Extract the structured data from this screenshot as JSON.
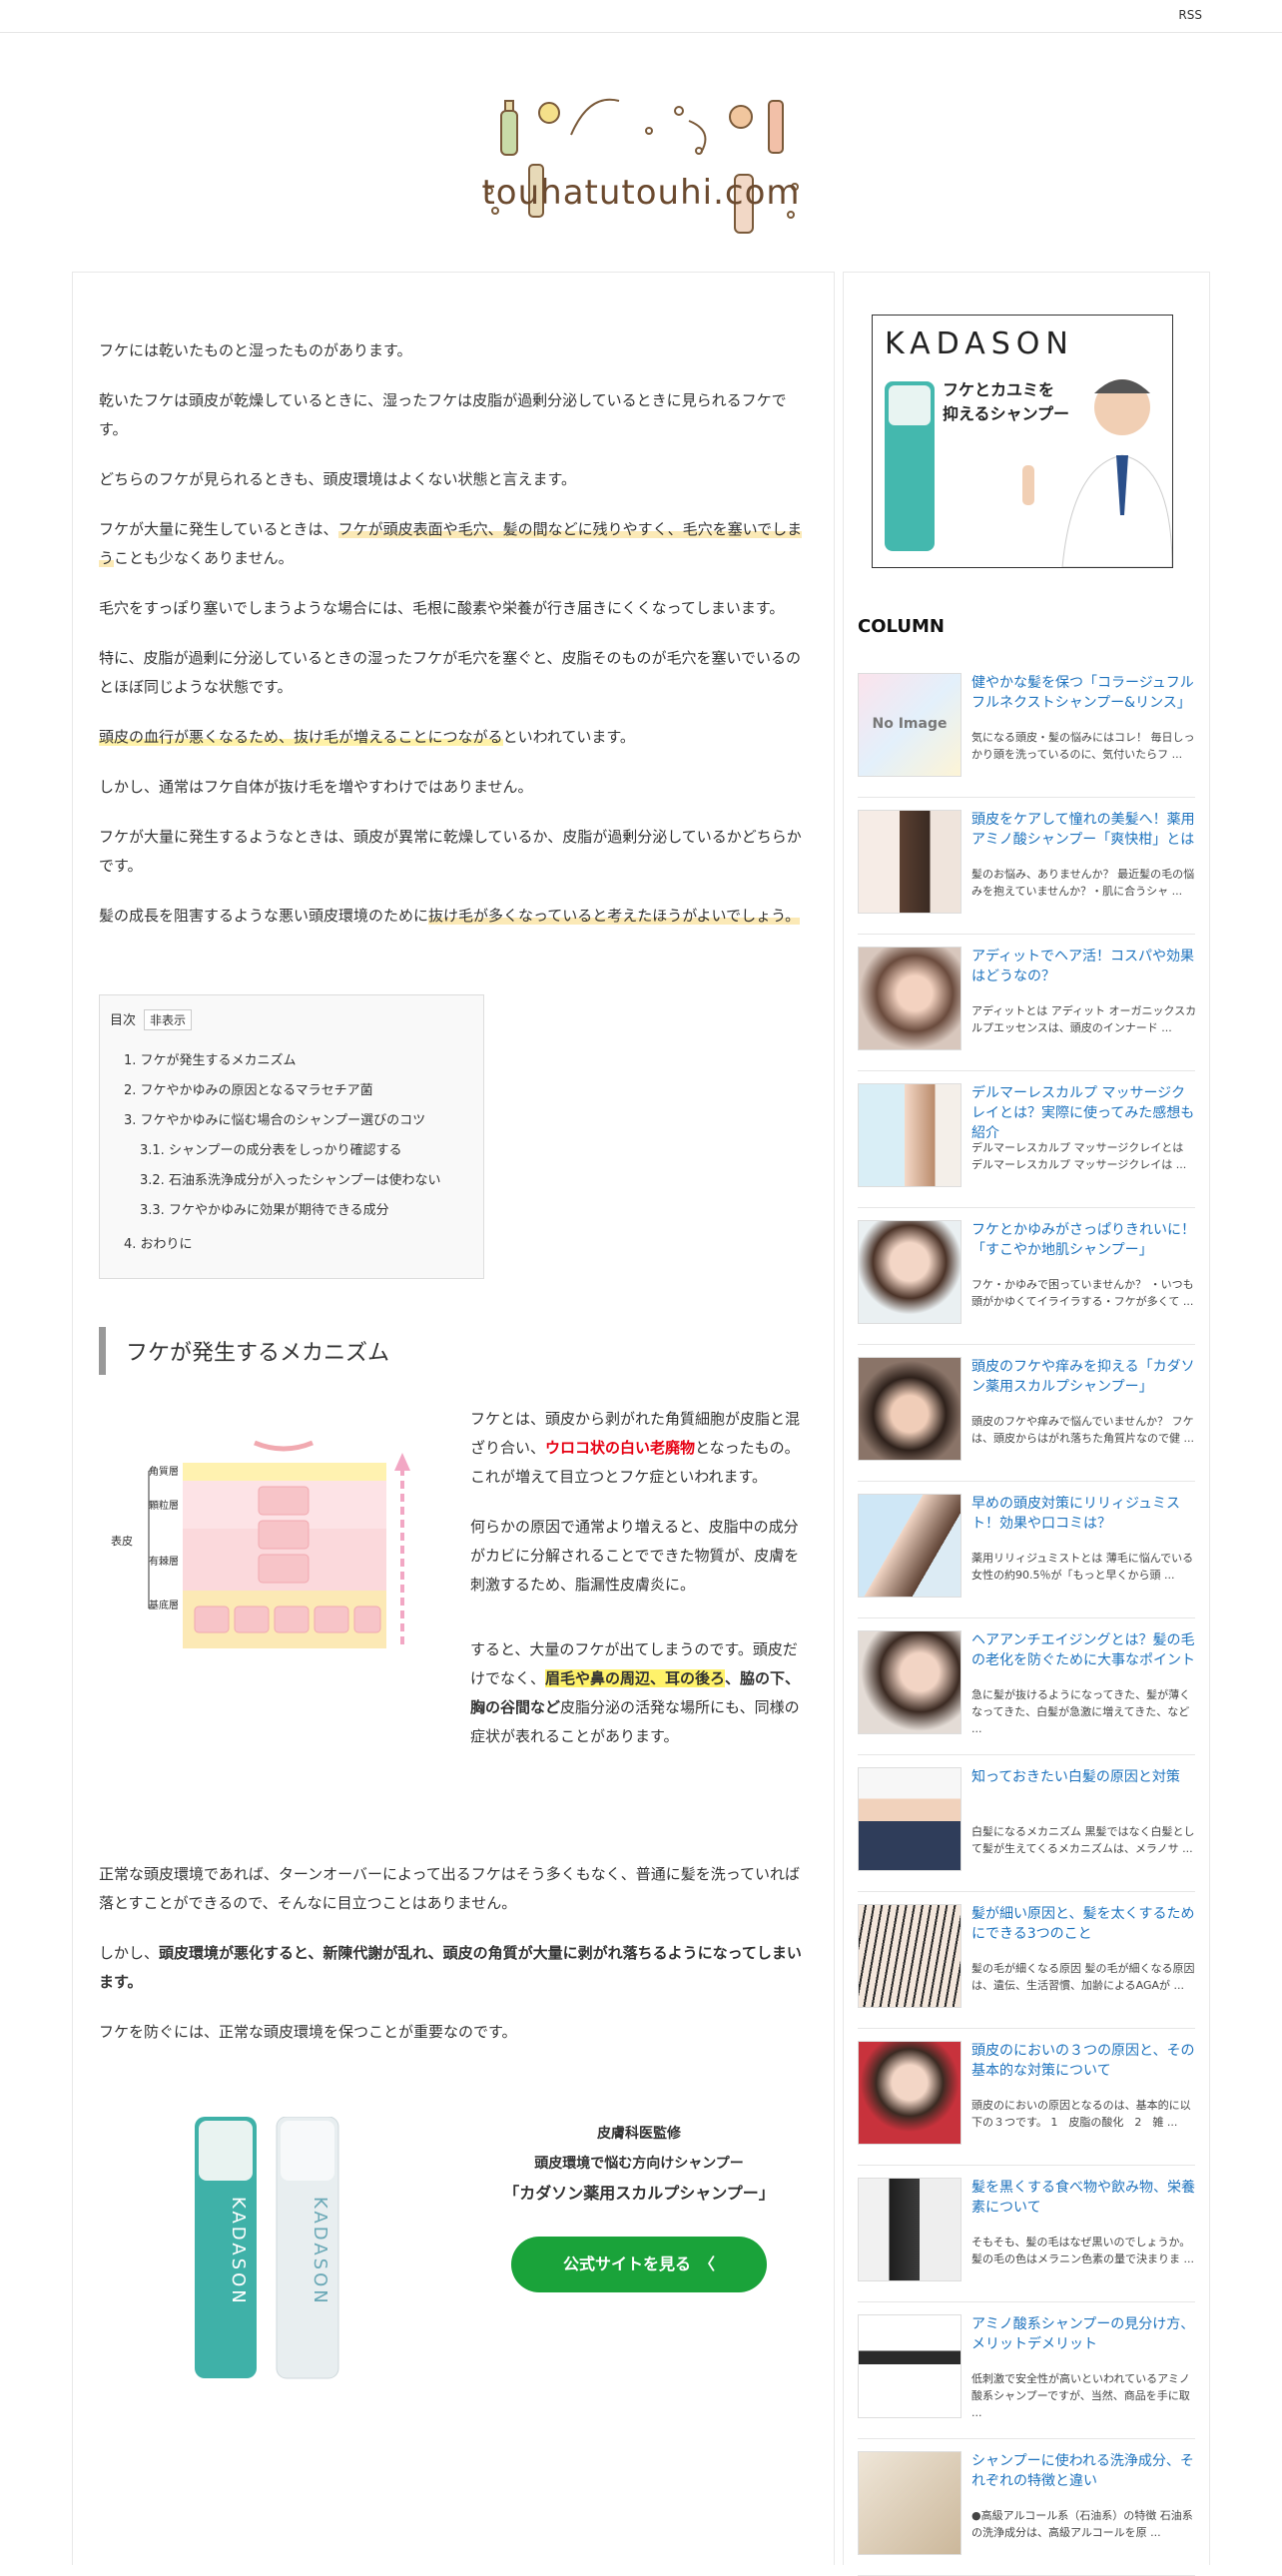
{
  "header": {
    "rss": "RSS",
    "logo_text": "touhatutouhi.com"
  },
  "article": {
    "paragraphs": [
      "フケには乾いたものと湿ったものがあります。",
      "乾いたフケは頭皮が乾燥しているときに、湿ったフケは皮脂が過剰分泌しているときに見られるフケです。",
      "どちらのフケが見られるときも、頭皮環境はよくない状態と言えます。"
    ],
    "p4_a": "フケが大量に発生しているときは、",
    "p4_b": "フケが頭皮表面や毛穴、髪の間などに残りやすく、毛穴を塞いでしまう",
    "p4_c": "ことも少なくありません。",
    "p5": "毛穴をすっぽり塞いでしまうような場合には、毛根に酸素や栄養が行き届きにくくなってしまいます。",
    "p6": "特に、皮脂が過剰に分泌しているときの湿ったフケが毛穴を塞ぐと、皮脂そのものが毛穴を塞いでいるのとほぼ同じような状態です。",
    "p7_a": "頭皮の血行が悪くなるため、抜け毛が増えることにつながる",
    "p7_b": "といわれています。",
    "p8": "しかし、通常はフケ自体が抜け毛を増やすわけではありません。",
    "p9": "フケが大量に発生するようなときは、頭皮が異常に乾燥しているか、皮脂が過剰分泌しているかどちらかです。",
    "p10_a": "髪の成長を阻害するような悪い頭皮環境のために",
    "p10_b": "抜け毛が多くなっていると考えたほうがよいでしょう。"
  },
  "toc": {
    "label": "目次",
    "toggle": "非表示",
    "items": [
      "1. フケが発生するメカニズム",
      "2. フケやかゆみの原因となるマラセチア菌",
      "3. フケやかゆみに悩む場合のシャンプー選びのコツ",
      "3.1. シャンプーの成分表をしっかり確認する",
      "3.2. 石油系洗浄成分が入ったシャンプーは使わない",
      "3.3. フケやかゆみに効果が期待できる成分",
      "4. おわりに"
    ]
  },
  "section1": {
    "heading": "フケが発生するメカニズム",
    "diagram": {
      "layers": [
        "角質層",
        "顆粒層",
        "有棘層",
        "基底層"
      ],
      "group_label": "表皮"
    },
    "s1_a": "フケとは、頭皮から剥がれた角質細胞が皮脂と混ざり合い、",
    "s1_red": "ウロコ状の白い老廃物",
    "s1_b": "となったもの。これが増えて目立つとフケ症といわれます。",
    "s2": "何らかの原因で通常より増えると、皮脂中の成分がカビに分解されることでできた物質が、皮膚を刺激するため、脂漏性皮膚炎に。",
    "s3_a": "すると、大量のフケが出てしまうのです。頭皮だけでなく、",
    "s3_b": "眉毛や鼻の周辺、耳の後ろ",
    "s3_c": "、脇の下、胸の谷間など",
    "s3_d": "皮脂分泌の活発な場所にも、同様の症状が表れることがあります。",
    "p_after1": "正常な頭皮環境であれば、ターンオーバーによって出るフケはそう多くもなく、普通に髪を洗っていれば落とすことができるので、そんなに目立つことはありません。",
    "p_after2_a": "しかし、",
    "p_after2_b": "頭皮環境が悪化すると、新陳代謝が乱れ、頭皮の角質が大量に剥がれ落ちるようになってしまいます。",
    "p_after3": "フケを防ぐには、正常な頭皮環境を保つことが重要なのです。"
  },
  "ad": {
    "line1": "皮膚科医監修",
    "line2": "頭皮環境で悩む方向けシャンプー",
    "line3": "「カダソン薬用スカルプシャンプー」",
    "cta": "公式サイトを見る　〈",
    "bottle_brand": "KADASON"
  },
  "sidebar": {
    "banner_brand": "KADASON",
    "banner_copy1": "フケとカユミを",
    "banner_copy2": "抑えるシャンプー",
    "column_heading": "COLUMN",
    "no_image": "No Image",
    "items": [
      {
        "title": "健やかな髪を保つ「コラージュフルフルネクストシャンプー&リンス」",
        "excerpt": "気になる頭皮・髪の悩みにはコレ！ 毎日しっかり頭を洗っているのに、気付いたらフ ..."
      },
      {
        "title": "頭皮をケアして憧れの美髪へ！薬用アミノ酸シャンプー「爽快柑」とは",
        "excerpt": "髪のお悩み、ありませんか？ 最近髪の毛の悩みを抱えていませんか？・肌に合うシャ ..."
      },
      {
        "title": "アディットでヘア活！コスパや効果はどうなの？",
        "excerpt": "アディットとは アディット オーガニックスカルプエッセンスは、頭皮のインナード ..."
      },
      {
        "title": "デルマーレスカルプ マッサージクレイとは？実際に使ってみた感想も紹介",
        "excerpt": "デルマーレスカルプ マッサージクレイとは デルマーレスカルプ マッサージクレイは ..."
      },
      {
        "title": "フケとかゆみがさっぱりきれいに！「すこやか地肌シャンプー」",
        "excerpt": "フケ・かゆみで困っていませんか？ ・いつも頭がかゆくてイライラする・フケが多くて ..."
      },
      {
        "title": "頭皮のフケや痒みを抑える「カダソン薬用スカルプシャンプー」",
        "excerpt": "頭皮のフケや痒みで悩んでいませんか？ フケは、頭皮からはがれ落ちた角質片なので健 ..."
      },
      {
        "title": "早めの頭皮対策にリリィジュミスト！効果や口コミは？",
        "excerpt": "薬用リリィジュミストとは 薄毛に悩んでいる女性の約90.5％が「もっと早くから頭 ..."
      },
      {
        "title": "ヘアアンチエイジングとは？髪の毛の老化を防ぐために大事なポイント",
        "excerpt": "急に髪が抜けるようになってきた、髪が薄くなってきた、白髪が急激に増えてきた、など ..."
      },
      {
        "title": "知っておきたい白髪の原因と対策",
        "excerpt": "白髪になるメカニズム 黒髪ではなく白髪として髪が生えてくるメカニズムは、メラノサ ..."
      },
      {
        "title": "髪が細い原因と、髪を太くするためにできる3つのこと",
        "excerpt": "髪の毛が細くなる原因 髪の毛が細くなる原因は、遺伝、生活習慣、加齢によるAGAが ..."
      },
      {
        "title": "頭皮のにおいの３つの原因と、その基本的な対策について",
        "excerpt": "頭皮のにおいの原因となるのは、基本的に以下の３つです。 1　皮脂の酸化　2　雑 ..."
      },
      {
        "title": "髪を黒くする食べ物や飲み物、栄養素について",
        "excerpt": "そもそも、髪の毛はなぜ黒いのでしょうか。 髪の毛の色はメラニン色素の量で決まりま ..."
      },
      {
        "title": "アミノ酸系シャンプーの見分け方、メリットデメリット",
        "excerpt": "低刺激で安全性が高いといわれているアミノ酸系シャンプーですが、当然、商品を手に取 ..."
      },
      {
        "title": "シャンプーに使われる洗浄成分、それぞれの特徴と違い",
        "excerpt": "●高級アルコール系（石油系）の特徴 石油系の洗浄成分は、高級アルコールを原 ..."
      }
    ]
  }
}
